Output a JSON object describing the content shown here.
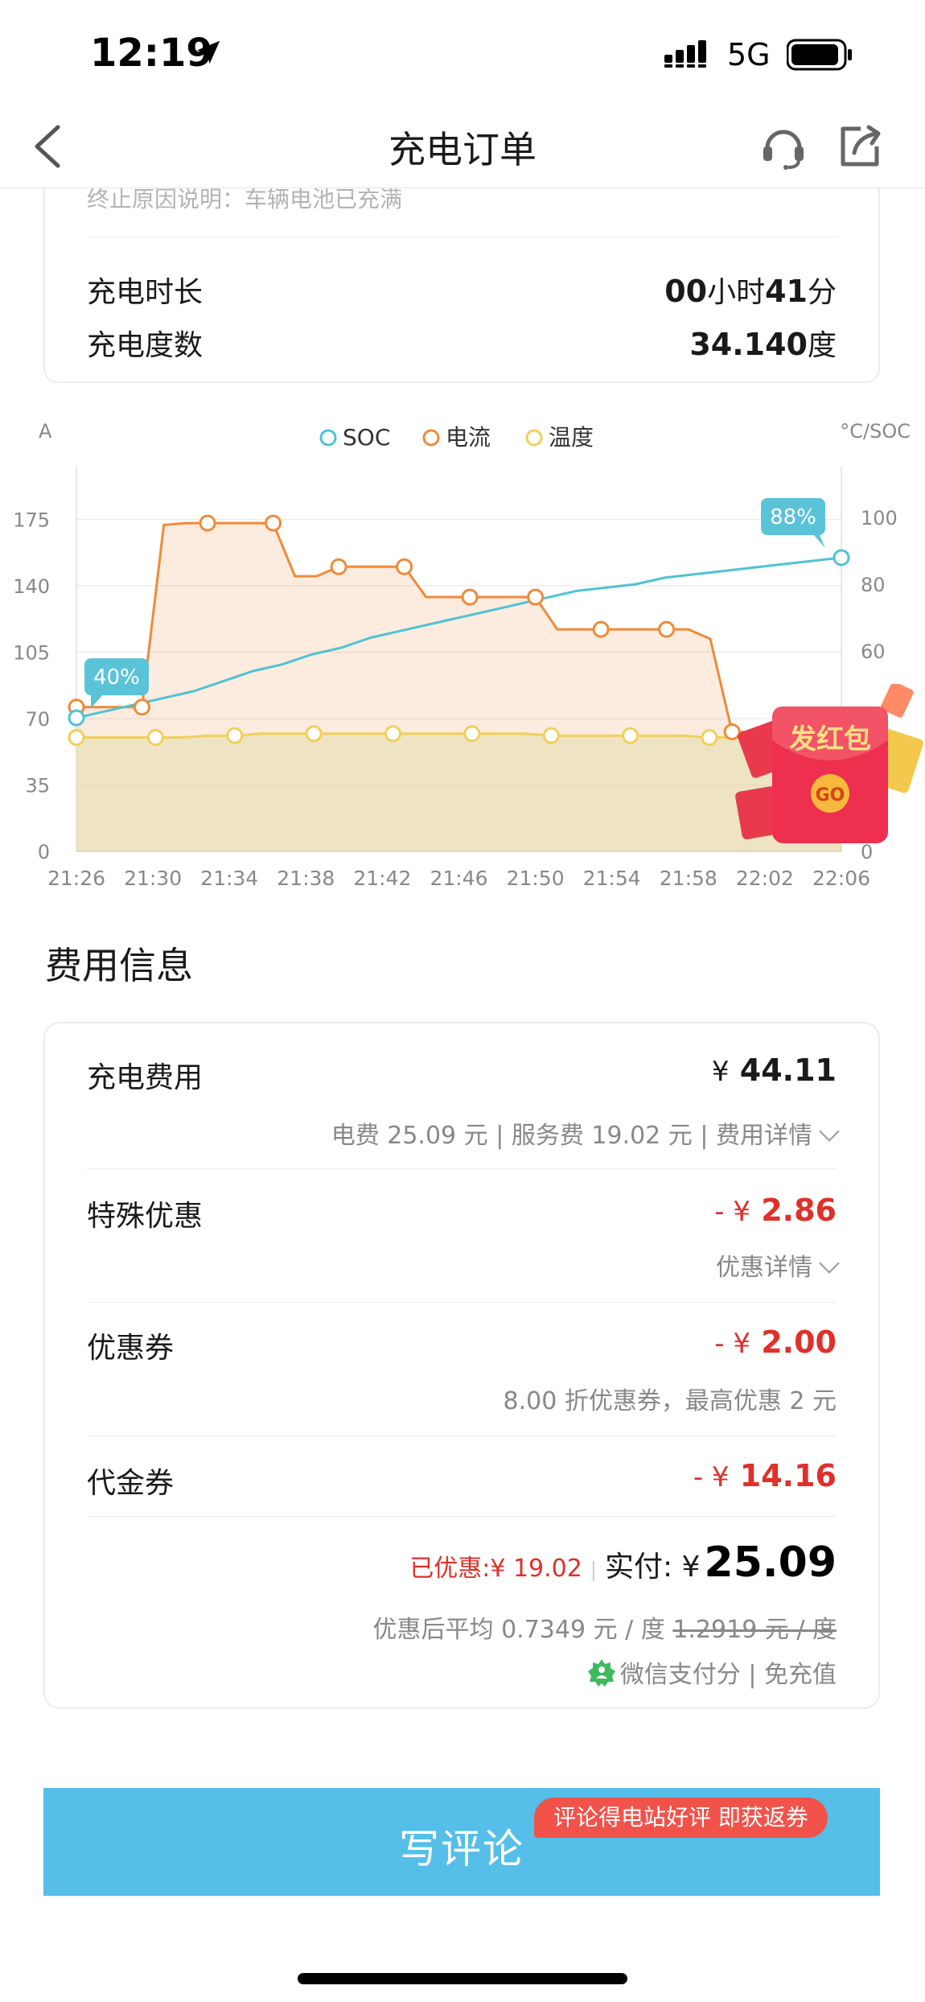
{
  "status_bar": {
    "time": "12:19",
    "network": "5G"
  },
  "nav": {
    "title": "充电订单"
  },
  "summary": {
    "stop_reason": "终止原因说明：车辆电池已充满",
    "duration_label": "充电时长",
    "duration_hours": "00",
    "duration_hours_unit": "小时",
    "duration_minutes": "41",
    "duration_minutes_unit": "分",
    "energy_label": "充电度数",
    "energy_value": "34.140",
    "energy_unit": "度"
  },
  "chart_data": {
    "type": "line",
    "left_axis_label": "A",
    "right_axis_label": "°C/SOC",
    "left_ticks": [
      "0",
      "35",
      "70",
      "105",
      "140",
      "175"
    ],
    "right_ticks": [
      "0",
      "20",
      "40",
      "60",
      "80",
      "100"
    ],
    "x_ticks": [
      "21:26",
      "21:30",
      "21:34",
      "21:38",
      "21:42",
      "21:46",
      "21:50",
      "21:54",
      "21:58",
      "22:02",
      "22:06"
    ],
    "left_ylim": [
      0,
      190
    ],
    "right_ylim": [
      0,
      108
    ],
    "legend": [
      "SOC",
      "电流",
      "温度"
    ],
    "legend_position": "top-center",
    "colors": {
      "soc": "#4fc3d3",
      "current": "#ef8a3a",
      "temp": "#f2cf5a",
      "soc_label_bg": "#5bc3d8"
    },
    "series": [
      {
        "name": "SOC",
        "axis": "right",
        "values": [
          40,
          42,
          44,
          46,
          48,
          51,
          54,
          56,
          59,
          61,
          64,
          66,
          68,
          70,
          72,
          74,
          76,
          78,
          79,
          80,
          82,
          83,
          84,
          85,
          86,
          87,
          88
        ]
      },
      {
        "name": "电流",
        "axis": "left",
        "values": [
          76,
          76,
          76,
          76,
          172,
          173,
          173,
          173,
          173,
          173,
          145,
          145,
          150,
          150,
          150,
          150,
          134,
          134,
          134,
          134,
          134,
          134,
          117,
          117,
          117,
          117,
          117,
          117,
          117,
          112,
          63,
          63,
          63,
          63,
          63,
          63
        ]
      },
      {
        "name": "温度",
        "axis": "left",
        "values": [
          60,
          60,
          60,
          60,
          60,
          61,
          61,
          62,
          62,
          62,
          62,
          62,
          62,
          62,
          62,
          62,
          62,
          62,
          61,
          61,
          61,
          61,
          61,
          61,
          60,
          60,
          60,
          60,
          59,
          59
        ]
      }
    ],
    "annotations": [
      {
        "text": "40%",
        "x_index": 0
      },
      {
        "text": "88%",
        "x_index": 26
      }
    ]
  },
  "fee": {
    "section_title": "费用信息",
    "charge_label": "充电费用",
    "charge_currency": "¥",
    "charge_amount": "44.11",
    "charge_breakdown": "电费 25.09 元 | 服务费 19.02 元 | 费用详情",
    "special_label": "特殊优惠",
    "special_prefix": "- ¥",
    "special_amount": "2.86",
    "special_detail": "优惠详情",
    "coupon_label": "优惠券",
    "coupon_prefix": "- ¥",
    "coupon_amount": "2.00",
    "coupon_detail": "8.00 折优惠券，最高优惠 2 元",
    "voucher_label": "代金券",
    "voucher_prefix": "- ¥",
    "voucher_amount": "14.16",
    "saved_text": "已优惠:¥ 19.02",
    "paid_label": "实付: ¥",
    "paid_amount": "25.09",
    "avg_text": "优惠后平均 0.7349 元 / 度",
    "avg_original": "1.2919 元 / 度",
    "wechat_text": "微信支付分 | 免充值"
  },
  "red_packet": {
    "text": "发红包",
    "go": "GO"
  },
  "review": {
    "button_label": "写评论",
    "tag": "评论得电站好评  即获返券"
  }
}
